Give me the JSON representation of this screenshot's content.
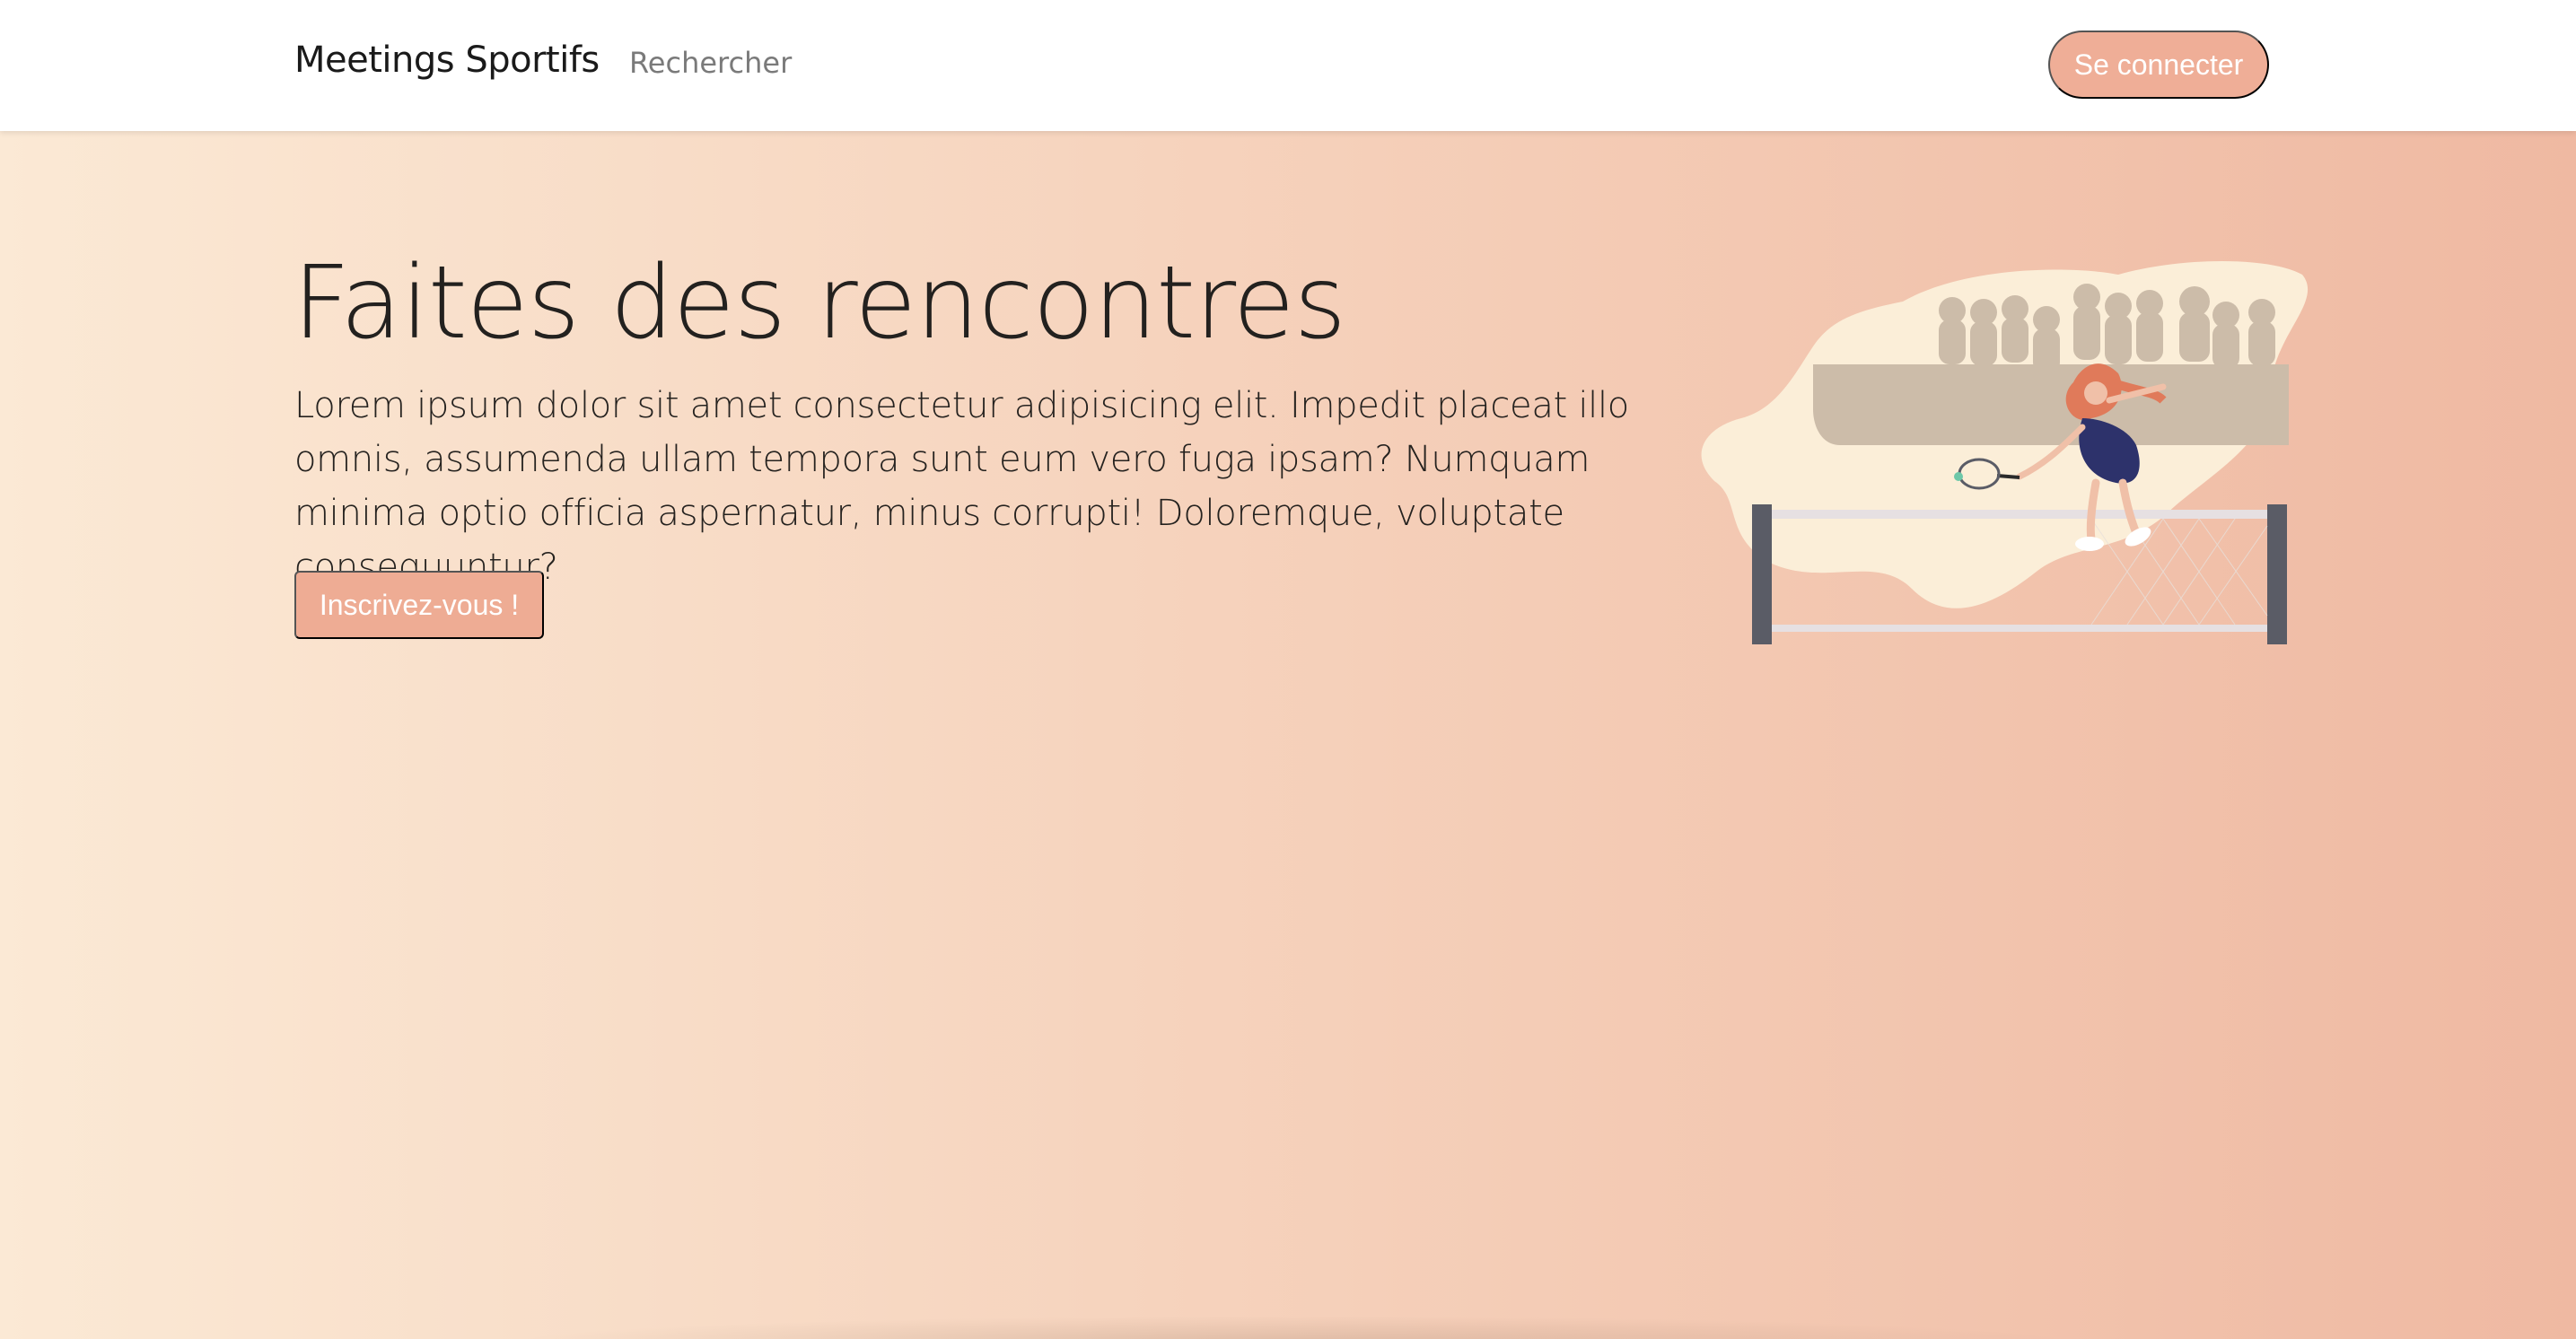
{
  "navbar": {
    "brand": "Meetings Sportifs",
    "search_link": "Rechercher",
    "login_button": "Se connecter"
  },
  "hero": {
    "title": "Faites des rencontres",
    "text": "Lorem ipsum dolor sit amet consectetur adipisicing elit. Impedit placeat illo omnis, assumenda ullam tempora sunt eum vero fuga ipsam? Numquam minima optio officia aspernatur, minus corrupti! Doloremque, voluptate consequuntur?",
    "cta_button": "Inscrivez-vous !"
  },
  "illustration": {
    "icon": "tennis-player-illustration"
  },
  "colors": {
    "accent": "#efae97",
    "gradient_start": "#fbe9d5",
    "gradient_end": "#efb9a2",
    "text": "#23211f"
  }
}
